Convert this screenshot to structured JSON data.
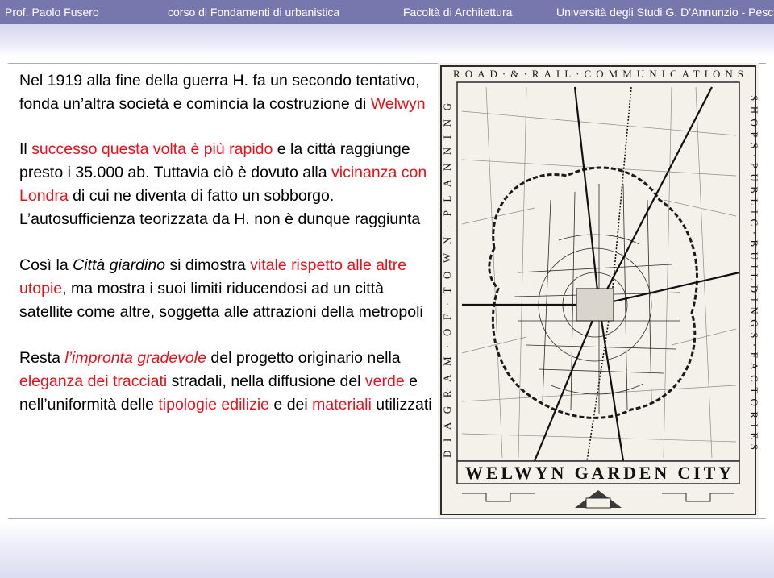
{
  "header": {
    "author": "Prof. Paolo Fusero",
    "course": "corso di Fondamenti di urbanistica",
    "faculty": "Facoltà di Architettura",
    "university": "Università degli Studi G. D’Annunzio - Pescara"
  },
  "colors": {
    "header_bar": "#7777ad",
    "accent_red": "#e8101a",
    "text": "#000000"
  },
  "paragraphs": [
    {
      "id": "p1",
      "segments": [
        {
          "text": "Nel 1919 alla fine della guerra H. fa un secondo tentativo, fonda un’altra società e comincia la costruzione di ",
          "style": "normal"
        },
        {
          "text": "Welwyn",
          "style": "red"
        }
      ]
    },
    {
      "id": "p2",
      "segments": [
        {
          "text": "Il ",
          "style": "normal"
        },
        {
          "text": "successo questa volta è più rapido",
          "style": "red"
        },
        {
          "text": " e la città raggiunge presto i 35.000 ab. Tuttavia ciò è dovuto alla ",
          "style": "normal"
        },
        {
          "text": "vicinanza con Londra",
          "style": "red"
        },
        {
          "text": " di cui ne diventa di fatto un sobborgo. L’autosufficienza teorizzata da H. non è dunque raggiunta",
          "style": "normal"
        }
      ]
    },
    {
      "id": "p3",
      "segments": [
        {
          "text": "Così la ",
          "style": "normal"
        },
        {
          "text": "Città giardino",
          "style": "italic"
        },
        {
          "text": " si dimostra ",
          "style": "normal"
        },
        {
          "text": "vitale rispetto alle altre utopie",
          "style": "red"
        },
        {
          "text": ", ma mostra i suoi limiti riducendosi ad un città satellite come altre, soggetta alle attrazioni della metropoli",
          "style": "normal"
        }
      ]
    },
    {
      "id": "p4",
      "segments": [
        {
          "text": "Resta ",
          "style": "normal"
        },
        {
          "text": "l’impronta gradevole",
          "style": "red-italic"
        },
        {
          "text": " del progetto originario nella ",
          "style": "normal"
        },
        {
          "text": "eleganza dei tracciati",
          "style": "red"
        },
        {
          "text": " stradali, nella diffusione del ",
          "style": "normal"
        },
        {
          "text": "verde",
          "style": "red"
        },
        {
          "text": " e nell’uniformità delle ",
          "style": "normal"
        },
        {
          "text": "tipologie edilizie",
          "style": "red"
        },
        {
          "text": " e dei ",
          "style": "normal"
        },
        {
          "text": "materiali",
          "style": "red"
        },
        {
          "text": " utilizzati",
          "style": "normal"
        }
      ]
    }
  ],
  "map": {
    "title_top": "ROAD·&·RAIL·COMMUNICATIONS",
    "title_main": "WELWYN GARDEN CITY",
    "side_right": "SHOPS·PUBLIC·BUILDINGS·FACTORIES",
    "side_left": "DIAGRAM·OF·TOWN·PLANNING"
  }
}
